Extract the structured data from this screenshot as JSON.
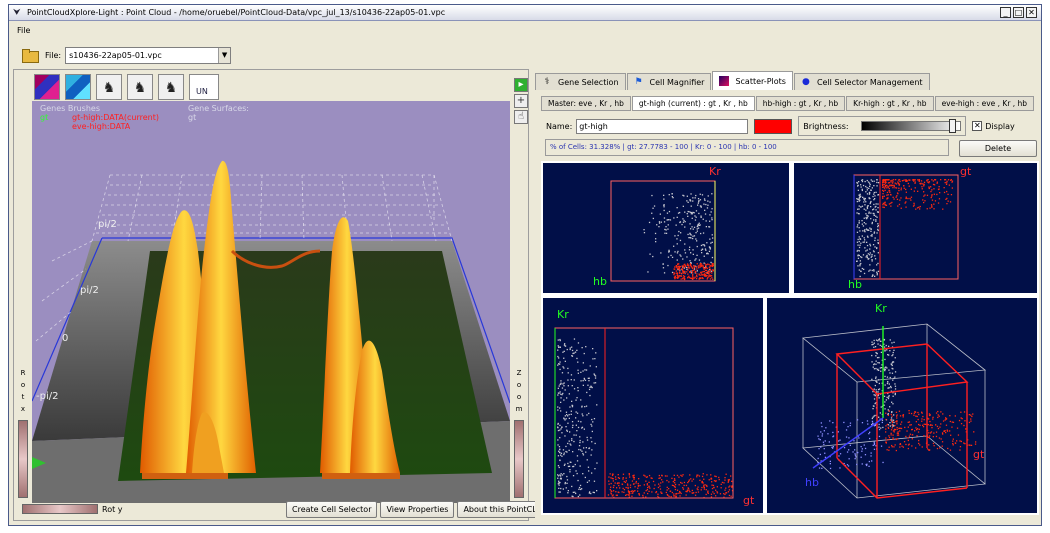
{
  "window": {
    "title": "PointCloudXplore-Light : Point Cloud - /home/oruebel/PointCloud-Data/vpc_jul_13/s10436-22ap05-01.vpc",
    "buttons": [
      "_",
      "□",
      "✕"
    ]
  },
  "menu": {
    "file": "File"
  },
  "filebar": {
    "label": "File:",
    "selected": "s10436-22ap05-01.vpc"
  },
  "left": {
    "view_tabs": [
      "brush-red-icon",
      "brush-blue-icon",
      "xy-tool-icon",
      "xz-tool-icon",
      "yz-tool-icon",
      "un-icon"
    ],
    "un_label": "UN",
    "overlay": {
      "genes_brushes": "Genes Brushes",
      "gt": "gt",
      "gt_high": "gt-high:DATA(current)",
      "eve_high": "eve-high:DATA",
      "gene_surfaces": "Gene Surfaces:",
      "gt_surface": "gt",
      "pi2": "pi/2",
      "zero": "0",
      "neg_pi2": "-pi/2"
    },
    "rotx": [
      "R",
      "o",
      "t",
      "x"
    ],
    "zoom": [
      "Z",
      "o",
      "o",
      "m"
    ],
    "roty": "Rot y",
    "buttons": {
      "create_cell_selector": "Create Cell Selector",
      "view_properties": "View Properties",
      "about": "About this PointCLoud"
    }
  },
  "right": {
    "tabs": [
      "Gene Selection",
      "Cell Magnifier",
      "Scatter-Plots",
      "Cell Selector Management"
    ],
    "active_tab": "Scatter-Plots",
    "sub_tabs": [
      "Master: eve , Kr , hb",
      "gt-high (current) : gt , Kr , hb",
      "hb-high : gt , Kr , hb",
      "Kr-high : gt , Kr , hb",
      "eve-high : eve , Kr , hb"
    ],
    "active_sub_tab": "gt-high (current) : gt , Kr , hb",
    "name_label": "Name:",
    "name_value": "gt-high",
    "brush_color": "#ff0000",
    "brightness_label": "Brightness:",
    "display_label": "Display",
    "display_checked": "✕",
    "info": "% of Cells: 31.328% | gt: 27.7783 - 100 | Kr: 0 - 100 | hb: 0 - 100",
    "delete_label": "Delete",
    "plots": {
      "p1": {
        "y_label": "Kr",
        "x_label": "hb"
      },
      "p2": {
        "y_label": "gt",
        "x_label": "hb"
      },
      "p3": {
        "y_label": "Kr",
        "x_label": "gt"
      },
      "p4": {
        "y_label": "Kr",
        "x_label": "gt",
        "z_label": "hb"
      }
    }
  },
  "colors": {
    "plot_bg": "#010f48",
    "selected": "#ff2a10",
    "unselected": "#c8c8d0",
    "kr_axis": "#22ff22",
    "hb_axis": "#4040ff"
  }
}
